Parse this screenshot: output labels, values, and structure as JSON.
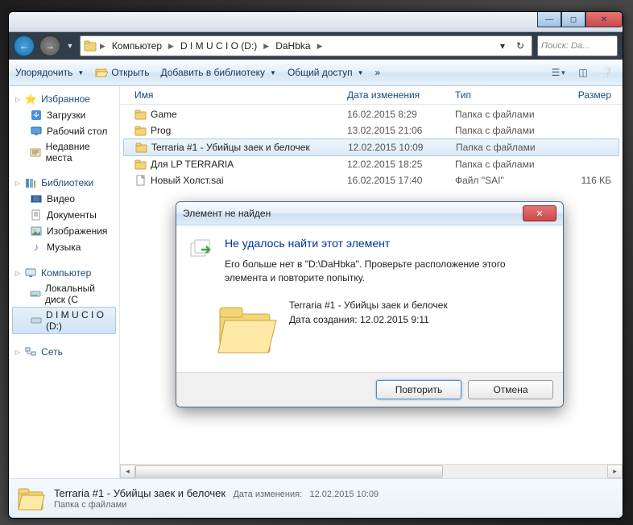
{
  "nav": {
    "breadcrumb": [
      "Компьютер",
      "D I M U C I O (D:)",
      "DaHbka"
    ]
  },
  "search": {
    "placeholder": "Поиск: Da..."
  },
  "toolbar": {
    "organize": "Упорядочить",
    "open": "Открыть",
    "include": "Добавить в библиотеку",
    "share": "Общий доступ"
  },
  "columns": {
    "name": "Имя",
    "date": "Дата изменения",
    "type": "Тип",
    "size": "Размер"
  },
  "sidebar": {
    "favorites": {
      "label": "Избранное",
      "items": [
        "Загрузки",
        "Рабочий стол",
        "Недавние места"
      ]
    },
    "libraries": {
      "label": "Библиотеки",
      "items": [
        "Видео",
        "Документы",
        "Изображения",
        "Музыка"
      ]
    },
    "computer": {
      "label": "Компьютер",
      "items": [
        "Локальный диск (C",
        "D I M U C I O (D:)"
      ]
    },
    "network": {
      "label": "Сеть"
    }
  },
  "files": [
    {
      "name": "Game",
      "date": "16.02.2015 8:29",
      "type": "Папка с файлами",
      "size": ""
    },
    {
      "name": "Prog",
      "date": "13.02.2015 21:06",
      "type": "Папка с файлами",
      "size": ""
    },
    {
      "name": "Terraria #1 - Убийцы заек и белочек",
      "date": "12.02.2015 10:09",
      "type": "Папка с файлами",
      "size": "",
      "selected": true
    },
    {
      "name": "Для LP TERRARIA",
      "date": "12.02.2015 18:25",
      "type": "Папка с файлами",
      "size": ""
    },
    {
      "name": "Новый Холст.sai",
      "date": "16.02.2015 17:40",
      "type": "Файл \"SAI\"",
      "size": "116 КБ",
      "isfile": true
    }
  ],
  "details": {
    "name": "Terraria #1 - Убийцы заек и белочек",
    "type": "Папка с файлами",
    "meta_label": "Дата изменения:",
    "meta_value": "12.02.2015 10:09"
  },
  "dialog": {
    "title": "Элемент не найден",
    "heading": "Не удалось найти этот элемент",
    "message": "Его больше нет в \"D:\\DaHbka\". Проверьте расположение этого элемента и повторите попытку.",
    "item_name": "Terraria #1 - Убийцы заек и белочек",
    "item_created_label": "Дата создания:",
    "item_created": "12.02.2015 9:11",
    "retry": "Повторить",
    "cancel": "Отмена"
  }
}
